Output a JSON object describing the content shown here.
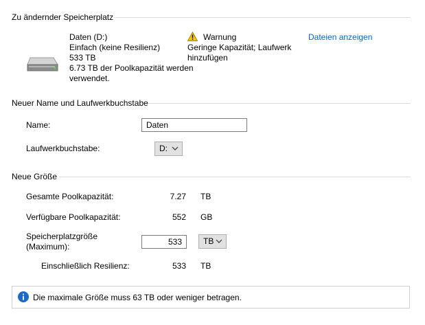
{
  "section_storage": {
    "title": "Zu ändernder Speicherplatz",
    "drive_name": "Daten (D:)",
    "drive_resiliency": "Einfach (keine Resilienz)",
    "drive_size": "533 TB",
    "drive_pool_line1": "6.73 TB der Poolkapazität werden",
    "drive_pool_line2": "verwendet.",
    "warning_title": "Warnung",
    "warning_line1": "Geringe Kapazität; Laufwerk",
    "warning_line2": "hinzufügen",
    "show_files_link": "Dateien anzeigen"
  },
  "section_name": {
    "title": "Neuer Name und Laufwerkbuchstabe",
    "name_label": "Name:",
    "name_value": "Daten",
    "letter_label": "Laufwerkbuchstabe:",
    "letter_value": "D:"
  },
  "section_size": {
    "title": "Neue Größe",
    "total_label": "Gesamte Poolkapazität:",
    "total_value": "7.27",
    "total_unit": "TB",
    "available_label": "Verfügbare Poolkapazität:",
    "available_value": "552",
    "available_unit": "GB",
    "size_label_line1": "Speicherplatzgröße",
    "size_label_line2": "(Maximum):",
    "size_value": "533",
    "size_unit": "TB",
    "resiliency_label": "Einschließlich Resilienz:",
    "resiliency_value": "533",
    "resiliency_unit": "TB"
  },
  "info_message": "Die maximale Größe muss 63 TB oder weniger betragen.",
  "colors": {
    "link": "#0066cc",
    "info_icon": "#1b6ac9",
    "warning_icon": "#f2c811"
  }
}
